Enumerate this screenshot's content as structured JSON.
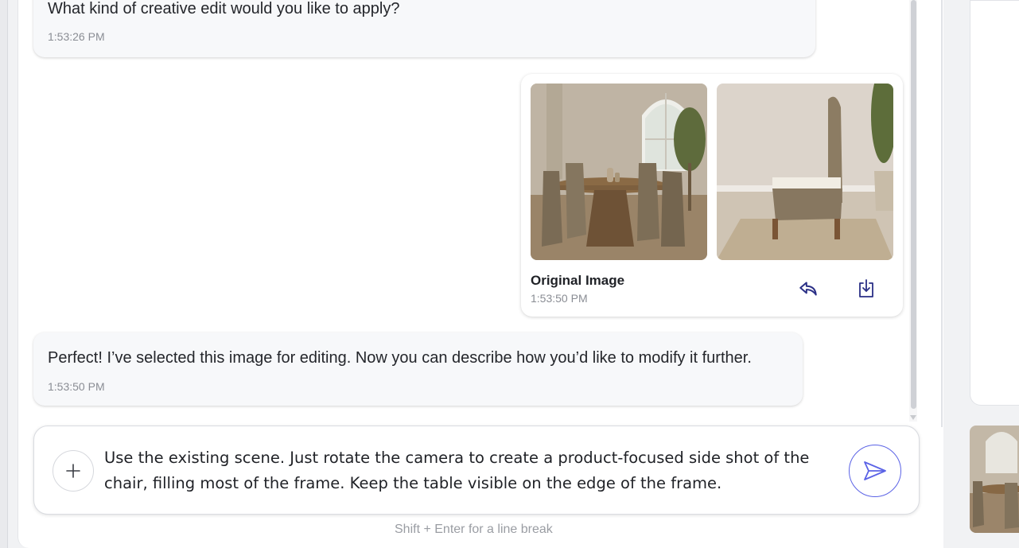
{
  "messages": {
    "prev_question": {
      "text": "What kind of creative edit would you like to apply?",
      "time": "1:53:26 PM"
    },
    "image_result": {
      "title": "Original Image",
      "time": "1:53:50 PM",
      "images": [
        "dining-room-scene",
        "chair-side-view"
      ]
    },
    "assistant_reply": {
      "text": "Perfect! I’ve selected this image for editing. Now you can describe how you’d like to modify it further.",
      "time": "1:53:50 PM"
    }
  },
  "composer": {
    "value": "Use the existing scene. Just rotate the camera to create a product-focused side shot of the chair, filling most of the frame. Keep the table visible on the edge of the frame.",
    "hint": "Shift + Enter for a line break",
    "icons": {
      "attach": "plus-icon",
      "send": "send-icon"
    }
  },
  "colors": {
    "accent": "#5b63e6",
    "icon": "#2a2f86",
    "bubble": "#f7f8fa"
  }
}
